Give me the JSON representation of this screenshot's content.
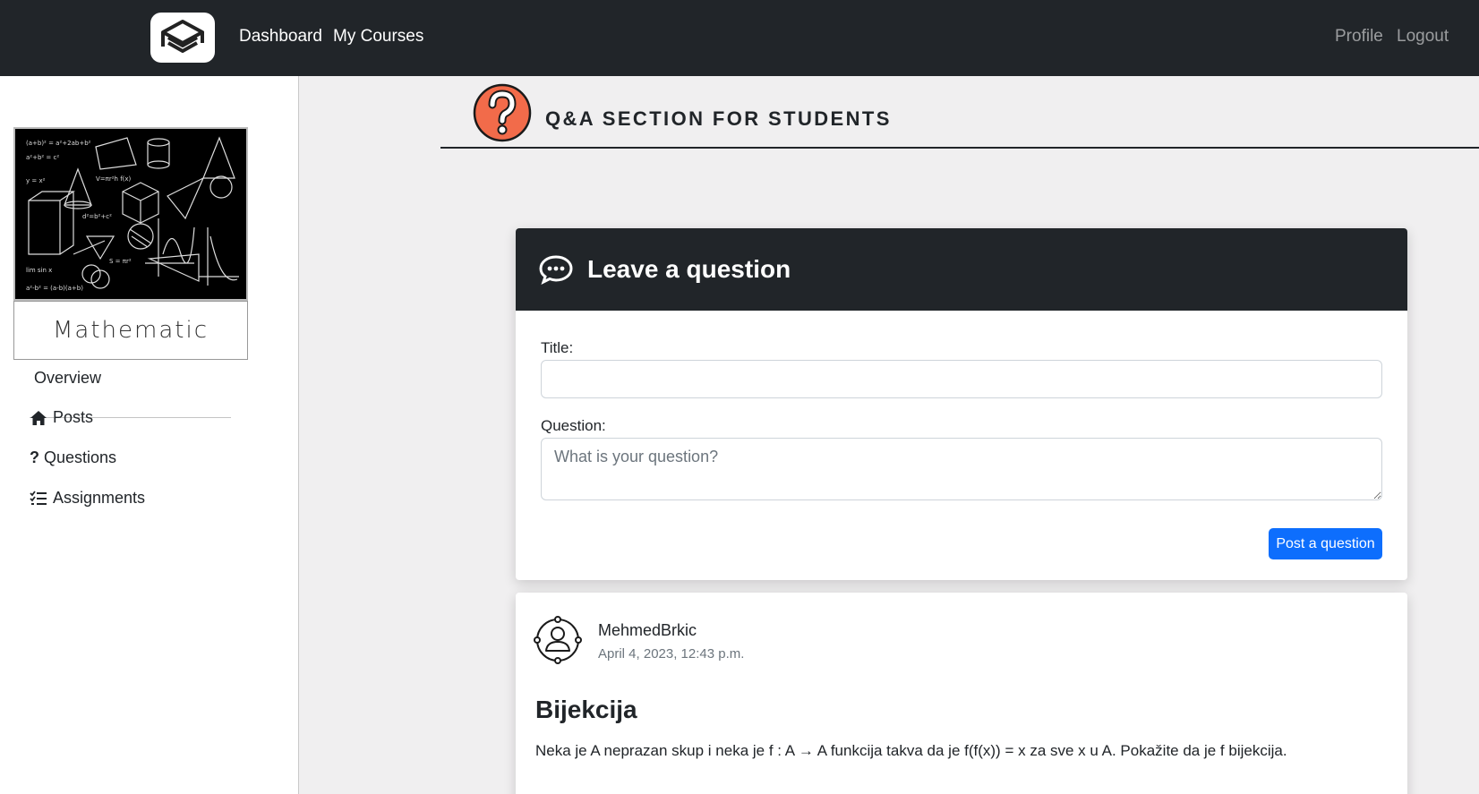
{
  "nav": {
    "links": [
      "Dashboard",
      "My Courses"
    ],
    "right_links": [
      "Profile",
      "Logout"
    ]
  },
  "sidebar": {
    "course_name": "Mathematic",
    "overview": "Overview",
    "items": [
      {
        "label": "Posts",
        "icon": "home-icon"
      },
      {
        "label": "Questions",
        "icon": "question-mark-icon"
      },
      {
        "label": "Assignments",
        "icon": "checklist-icon"
      }
    ]
  },
  "section": {
    "title": "Q&A SECTION FOR STUDENTS",
    "icon": "question-circle-icon",
    "icon_color": "#f26b4a"
  },
  "form": {
    "header": "Leave a question",
    "header_icon": "chat-bubble-icon",
    "title_label": "Title:",
    "title_value": "",
    "question_label": "Question:",
    "question_placeholder": "What is your question?",
    "submit_label": "Post a question",
    "submit_color": "#0d6efd"
  },
  "posts": [
    {
      "author": "MehmedBrkic",
      "date": "April 4, 2023, 12:43 p.m.",
      "title": "Bijekcija",
      "body": "Neka je A neprazan skup i neka je f : A → A funkcija takva da je f(f(x)) = x za sve x u A. Pokažite da je f bijekcija."
    }
  ]
}
